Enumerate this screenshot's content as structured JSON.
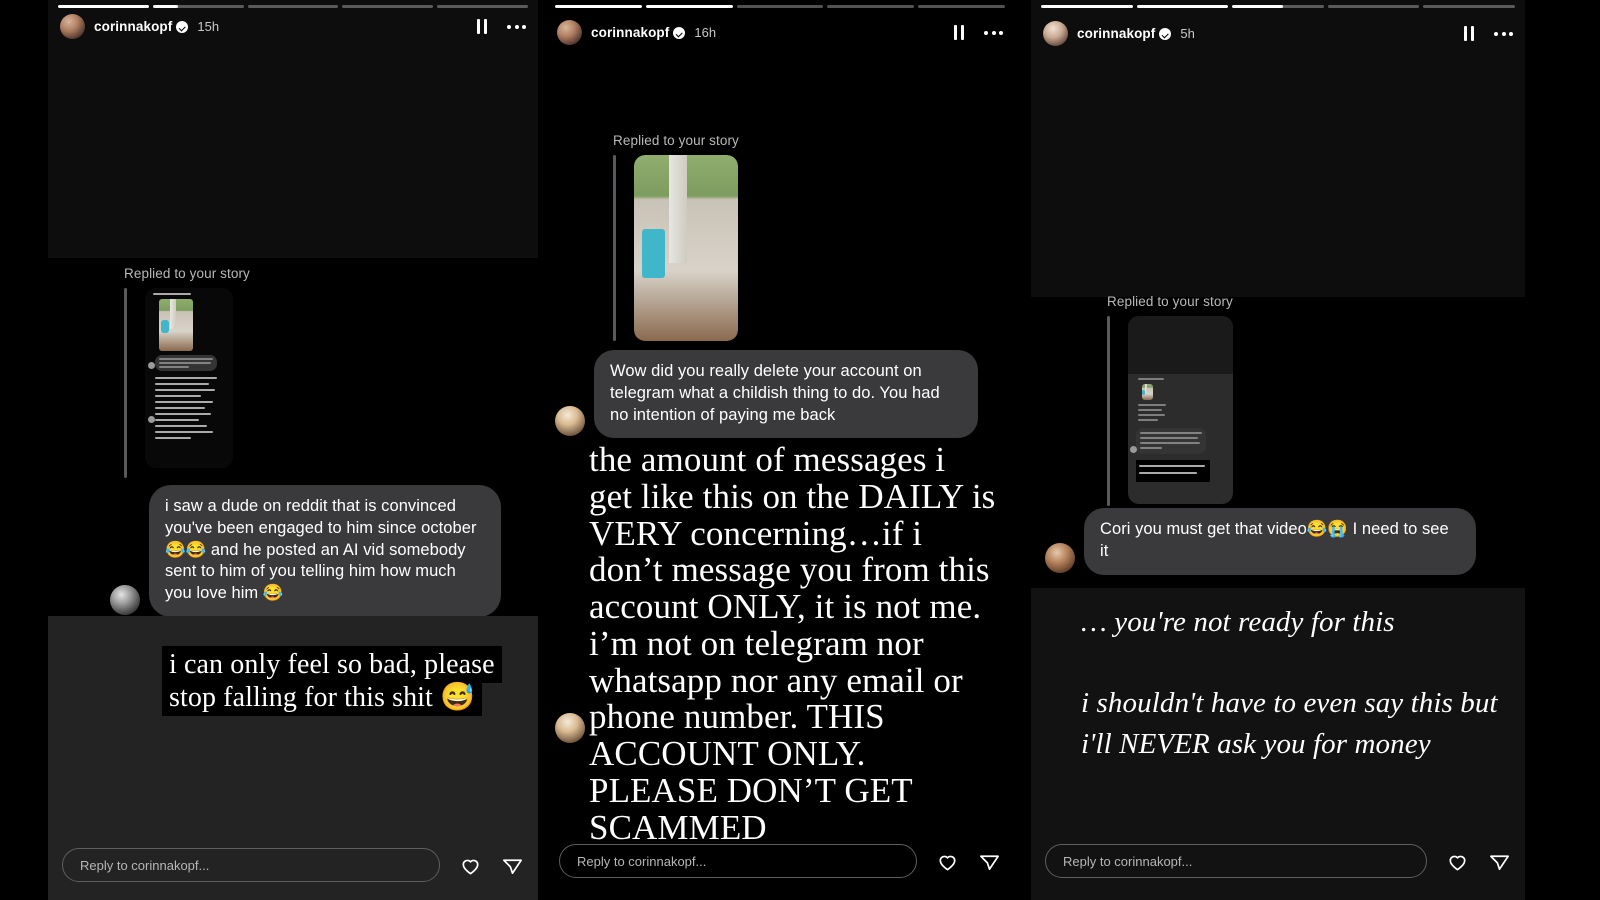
{
  "app": "instagram-stories",
  "colors": {
    "background": "#000000",
    "bubble": "#3a3a3c",
    "accent": "#ffffff",
    "muted": "#b9b9b9"
  },
  "panels": [
    {
      "id": "panel-1",
      "header": {
        "username": "corinnakopf",
        "timestamp": "15h",
        "verified": true,
        "pause_label": "Pause",
        "more_label": "More options"
      },
      "progress": {
        "segments": 5,
        "active_index": 1,
        "active_fill_pct": 28
      },
      "reply_context": {
        "label": "Replied to your story"
      },
      "message": {
        "text": "i saw a dude on reddit that is convinced you've been engaged to him since october 😂😂 and he posted an AI vid somebody sent to him of you telling him how much you love him 😂"
      },
      "caption": {
        "text": "i can only feel so bad, please stop falling for this shit 😅"
      },
      "footer": {
        "placeholder": "Reply to corinnakopf...",
        "like_label": "Like",
        "share_label": "Share"
      }
    },
    {
      "id": "panel-2",
      "header": {
        "username": "corinnakopf",
        "timestamp": "16h",
        "verified": true,
        "pause_label": "Pause",
        "more_label": "More options"
      },
      "progress": {
        "segments": 5,
        "active_index": 1,
        "active_fill_pct": 100
      },
      "reply_context": {
        "label": "Replied to your story"
      },
      "message": {
        "text": "Wow did you really delete your account on telegram what a childish thing to do. You had no intention of paying me back"
      },
      "caption": {
        "text": "the amount of messages i get like this on the DAILY is VERY concerning…if i don’t message you from this account ONLY, it is not me. i’m not on telegram nor whatsapp nor any email or phone number. THIS ACCOUNT ONLY. PLEASE DON’T GET SCAMMED"
      },
      "footer": {
        "placeholder": "Reply to corinnakopf...",
        "like_label": "Like",
        "share_label": "Share"
      }
    },
    {
      "id": "panel-3",
      "header": {
        "username": "corinnakopf",
        "timestamp": "5h",
        "verified": true,
        "pause_label": "Pause",
        "more_label": "More options"
      },
      "progress": {
        "segments": 5,
        "active_index": 2,
        "active_fill_pct": 55
      },
      "reply_context": {
        "label": "Replied to your story"
      },
      "message": {
        "text": "Cori you must get that video😂😭 I need to see it"
      },
      "caption": {
        "line1": "… you're not ready for this",
        "line2": "i shouldn't have to even say this but i'll NEVER ask you for money"
      },
      "footer": {
        "placeholder": "Reply to corinnakopf...",
        "like_label": "Like",
        "share_label": "Share"
      }
    }
  ]
}
